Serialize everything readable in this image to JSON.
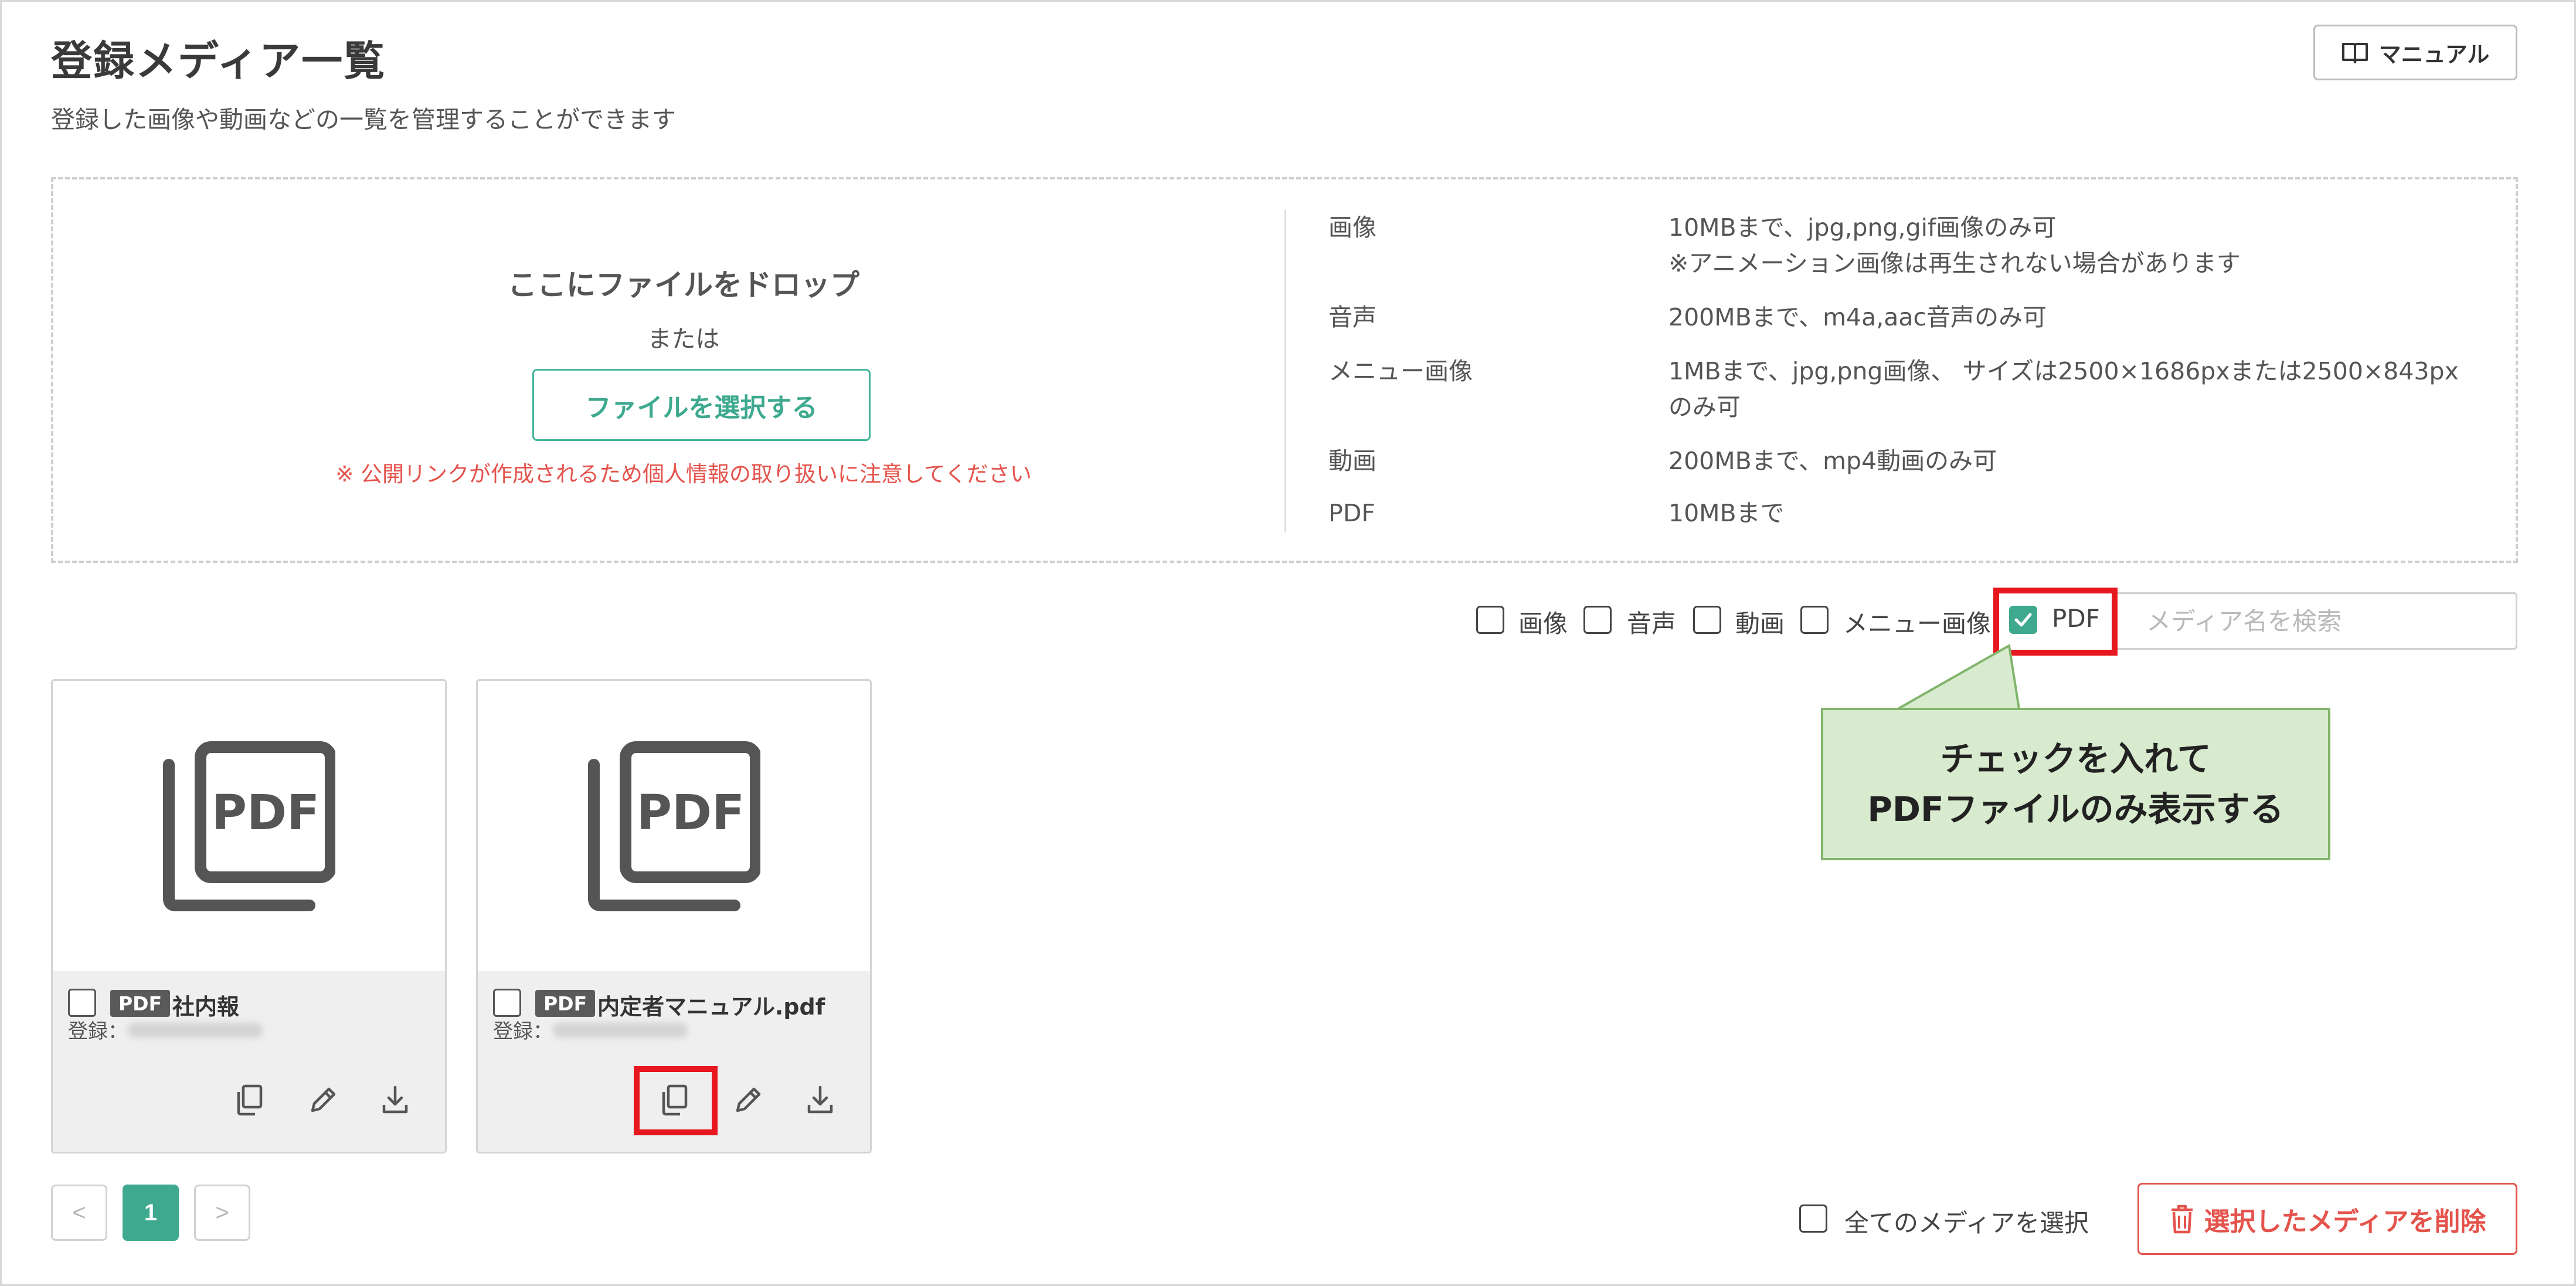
{
  "header": {
    "title": "登録メディア一覧",
    "subtitle": "登録した画像や動画などの一覧を管理することができます",
    "manual_button": "マニュアル",
    "manual_icon": "book-open-icon"
  },
  "upload": {
    "drop_title": "ここにファイルをドロップ",
    "or": "または",
    "select_button": "ファイルを選択する",
    "notice": "※ 公開リンクが作成されるため個人情報の取り扱いに注意してください",
    "notice_color": "#e4534c",
    "specs": [
      {
        "label": "画像",
        "value": "10MBまで、jpg,png,gif画像のみ可",
        "value2": "※アニメーション画像は再生されない場合があります"
      },
      {
        "label": "音声",
        "value": "200MBまで、m4a,aac音声のみ可"
      },
      {
        "label": "メニュー画像",
        "value": "1MBまで、jpg,png画像、 サイズは2500×1686pxまたは2500×843px",
        "value2": "のみ可"
      },
      {
        "label": "動画",
        "value": "200MBまで、mp4動画のみ可"
      },
      {
        "label": "PDF",
        "value": "10MBまで"
      }
    ]
  },
  "filters": [
    {
      "label": "画像",
      "checked": false
    },
    {
      "label": "音声",
      "checked": false
    },
    {
      "label": "動画",
      "checked": false
    },
    {
      "label": "メニュー画像",
      "checked": false
    },
    {
      "label": "PDF",
      "checked": true
    }
  ],
  "search": {
    "placeholder": "メディア名を検索",
    "value": ""
  },
  "callout": {
    "line1": "チェックを入れて",
    "line2": "PDFファイルのみ表示する",
    "bg_color": "#d8ebcf",
    "highlight_color": "#e6171e"
  },
  "media": [
    {
      "type_badge": "PDF",
      "name": "社内報",
      "registered_label": "登録：",
      "thumb_icon": "pdf-file-icon",
      "actions": [
        "copy-icon",
        "pencil-icon",
        "download-icon"
      ]
    },
    {
      "type_badge": "PDF",
      "name": "内定者マニュアル.pdf",
      "registered_label": "登録：",
      "thumb_icon": "pdf-file-icon",
      "actions": [
        "copy-icon",
        "pencil-icon",
        "download-icon"
      ]
    }
  ],
  "pagination": {
    "prev": "<",
    "current": "1",
    "next": ">"
  },
  "footer": {
    "select_all": "全てのメディアを選択",
    "delete_button": "選択したメディアを削除",
    "delete_icon": "trash-icon"
  },
  "colors": {
    "accent": "#3ea98f",
    "danger": "#e4534c"
  }
}
